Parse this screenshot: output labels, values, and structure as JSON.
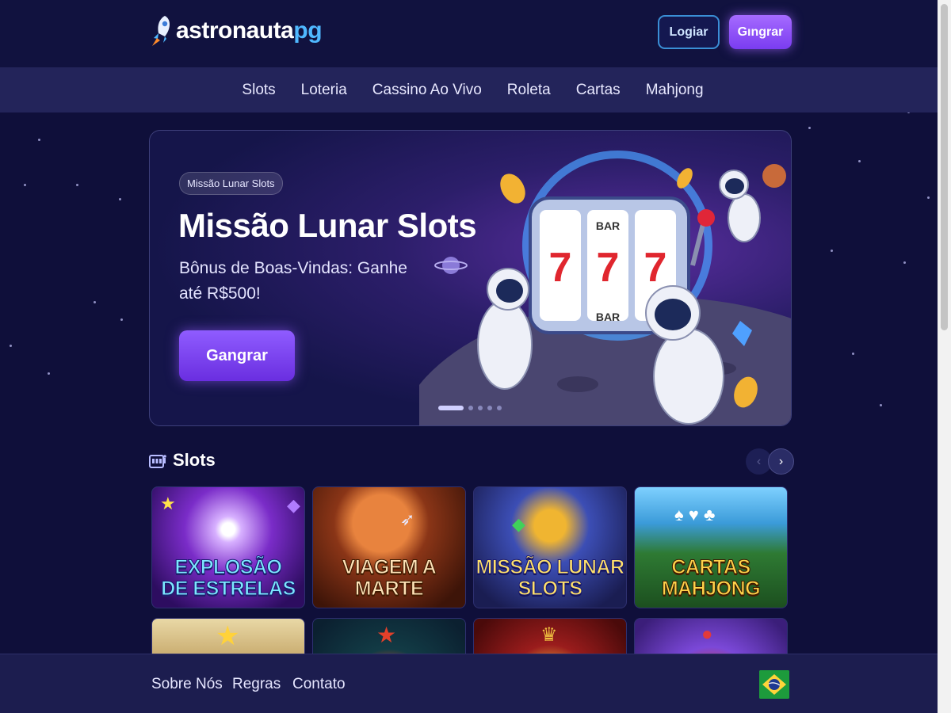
{
  "header": {
    "logo_part1": "astronauta",
    "logo_part2": "pg",
    "login_label": "Logiar",
    "register_label": "Gıngrar"
  },
  "nav": {
    "items": [
      "Slots",
      "Loteria",
      "Cassino Ao Vivo",
      "Roleta",
      "Cartas",
      "Mahjong"
    ]
  },
  "hero": {
    "badge": "Missão Lunar Slots",
    "title": "Missão Lunar Slots",
    "subtitle": "Bônus de Boas-Vindas: Ganhe até R$500!",
    "cta_label": "Gangrar",
    "carousel": {
      "slide_count": 5,
      "active_index": 0
    },
    "slot_reels": [
      "7",
      "7",
      "7"
    ],
    "slot_symbols": [
      "BAR",
      "BAR"
    ]
  },
  "section": {
    "title": "Slots",
    "games": [
      {
        "title": "EXPLOSÃO DE ESTRELAS"
      },
      {
        "title": "VIAGEM A MARTE"
      },
      {
        "title": "MISSÃO LUNAR SLOTS"
      },
      {
        "title": "CARTAS MAHJONG"
      },
      {
        "title": ""
      },
      {
        "title": ""
      },
      {
        "title": ""
      },
      {
        "title": ""
      }
    ]
  },
  "footer": {
    "links": [
      "Sobre Nós",
      "Regras",
      "Contato"
    ],
    "language_flag": "brazil-flag"
  },
  "colors": {
    "background": "#0f0f3a",
    "nav_background": "#23245a",
    "accent_purple": "#7a3cf0",
    "logo_blue": "#4fb8ff",
    "login_border": "#3a8fd6"
  }
}
